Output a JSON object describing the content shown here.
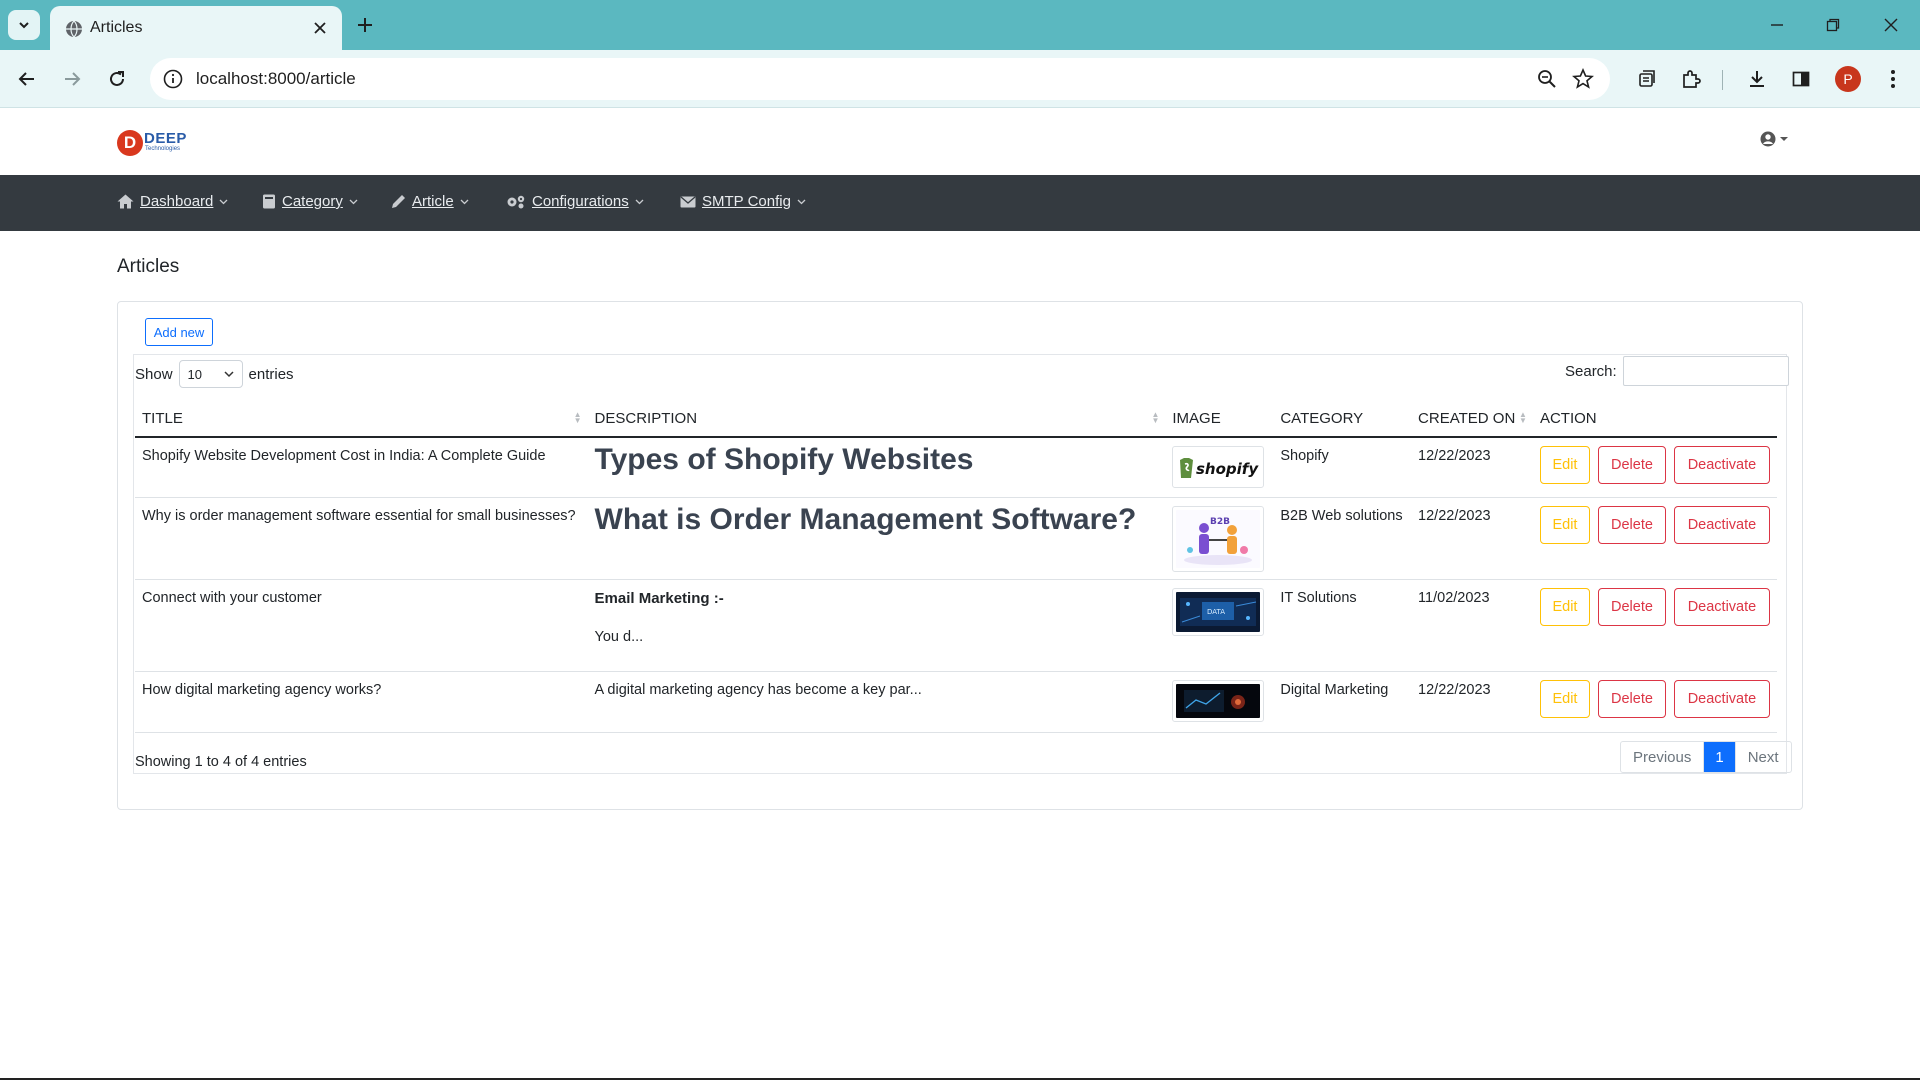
{
  "browser": {
    "tab_title": "Articles",
    "url": "localhost:8000/article",
    "profile_initial": "P"
  },
  "header": {
    "logo_letter": "D",
    "logo_name": "DEEP",
    "logo_sub": "Technologies"
  },
  "nav": {
    "items": [
      {
        "label": "Dashboard",
        "icon": "home-icon"
      },
      {
        "label": "Category",
        "icon": "book-icon"
      },
      {
        "label": "Article",
        "icon": "pencil-icon"
      },
      {
        "label": "Configurations",
        "icon": "gears-icon"
      },
      {
        "label": "SMTP Config",
        "icon": "envelope-icon"
      }
    ]
  },
  "page": {
    "title": "Articles",
    "add_new": "Add new",
    "show_label": "Show",
    "entries_label": "entries",
    "page_length": "10",
    "search_label": "Search:",
    "search_value": ""
  },
  "table": {
    "columns": [
      "TITLE",
      "DESCRIPTION",
      "IMAGE",
      "CATEGORY",
      "CREATED ON",
      "ACTION"
    ],
    "rows": [
      {
        "title": "Shopify Website Development Cost in India: A Complete Guide",
        "description_heading": "Types of Shopify Websites",
        "image": "shopify",
        "category": "Shopify",
        "created_on": "12/22/2023"
      },
      {
        "title": "Why is order management software essential for small businesses?",
        "description_heading": "What is Order Management Software?",
        "image": "b2b",
        "category": "B2B Web solutions",
        "created_on": "12/22/2023"
      },
      {
        "title": "Connect with your customer",
        "description_bold": "Email Marketing :-",
        "description_text": "You d...",
        "image": "it",
        "category": "IT Solutions",
        "created_on": "11/02/2023"
      },
      {
        "title": "How digital marketing agency works?",
        "description_text": "A digital marketing agency has become a key par...",
        "image": "digital",
        "category": "Digital Marketing",
        "created_on": "12/22/2023"
      }
    ],
    "actions": {
      "edit": "Edit",
      "delete": "Delete",
      "deactivate": "Deactivate"
    }
  },
  "footer": {
    "info": "Showing 1 to 4 of 4 entries",
    "previous": "Previous",
    "current_page": "1",
    "next": "Next"
  },
  "colors": {
    "tabbar": "#5bb8c0",
    "navbar": "#343a40",
    "primary": "#0d6efd",
    "warning": "#ffc107",
    "danger": "#dc3545"
  }
}
